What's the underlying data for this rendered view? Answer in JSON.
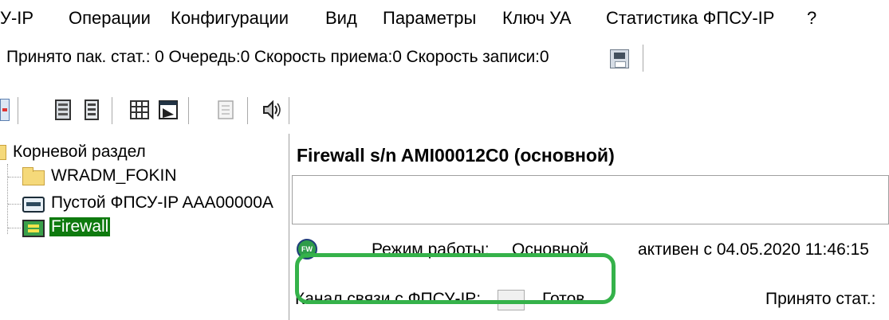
{
  "menu": {
    "items": [
      "У-IP",
      "Операции",
      "Конфигурации",
      "Вид",
      "Параметры",
      "Ключ УА",
      "Статистика ФПСУ-IP",
      "?"
    ]
  },
  "status_line": {
    "text": "Принято пак. стат.: 0 Очередь:0 Скорость приема:0 Скорость записи:0"
  },
  "toolbar": {
    "icons": [
      "tree-collapse-icon",
      "server-config-icon",
      "server-list-icon",
      "grid-icon",
      "window-icon",
      "disabled-doc-icon",
      "speaker-icon"
    ]
  },
  "tree": {
    "root": "Корневой раздел",
    "items": [
      {
        "label": "WRADM_FOKIN",
        "icon": "folder-icon"
      },
      {
        "label": "Пустой ФПСУ-IP AAA00000A",
        "icon": "device-icon"
      },
      {
        "label": "Firewall",
        "icon": "firewall-icon",
        "selected": true
      }
    ]
  },
  "panel": {
    "title": "Firewall s/n AMI00012C0 (основной)",
    "badge": "FW",
    "mode_label": "Режим работы:",
    "mode_value": "Основной",
    "active_text": "активен с 04.05.2020 11:46:15",
    "channel_label": "Канал связи с ФПСУ-IP:",
    "channel_button": "...",
    "channel_status": "Готов",
    "received_label": "Принято стат.:"
  },
  "colors": {
    "highlight": "#35b24a",
    "selection": "#0e7a0e"
  }
}
